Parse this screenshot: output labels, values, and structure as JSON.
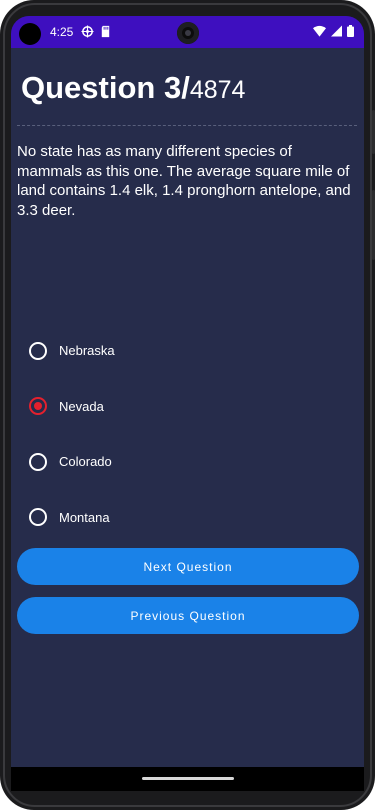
{
  "status_bar": {
    "time": "4:25",
    "icons": [
      "settings-gear-icon",
      "sd-card-icon",
      "wifi-icon",
      "signal-icon",
      "battery-icon"
    ]
  },
  "question": {
    "label": "Question 3/",
    "total": "4874",
    "text": "No state has as many different species of mammals as this one. The average square mile of land contains 1.4 elk, 1.4 pronghorn antelope, and 3.3 deer."
  },
  "options": [
    {
      "label": "Nebraska",
      "selected": false
    },
    {
      "label": "Nevada",
      "selected": true
    },
    {
      "label": "Colorado",
      "selected": false
    },
    {
      "label": "Montana",
      "selected": false
    }
  ],
  "buttons": {
    "next": "Next Question",
    "previous": "Previous Question"
  },
  "colors": {
    "status_bar": "#3e0fbf",
    "background": "#262c4b",
    "button": "#1a82e8",
    "radio_selected": "#e5202d"
  }
}
